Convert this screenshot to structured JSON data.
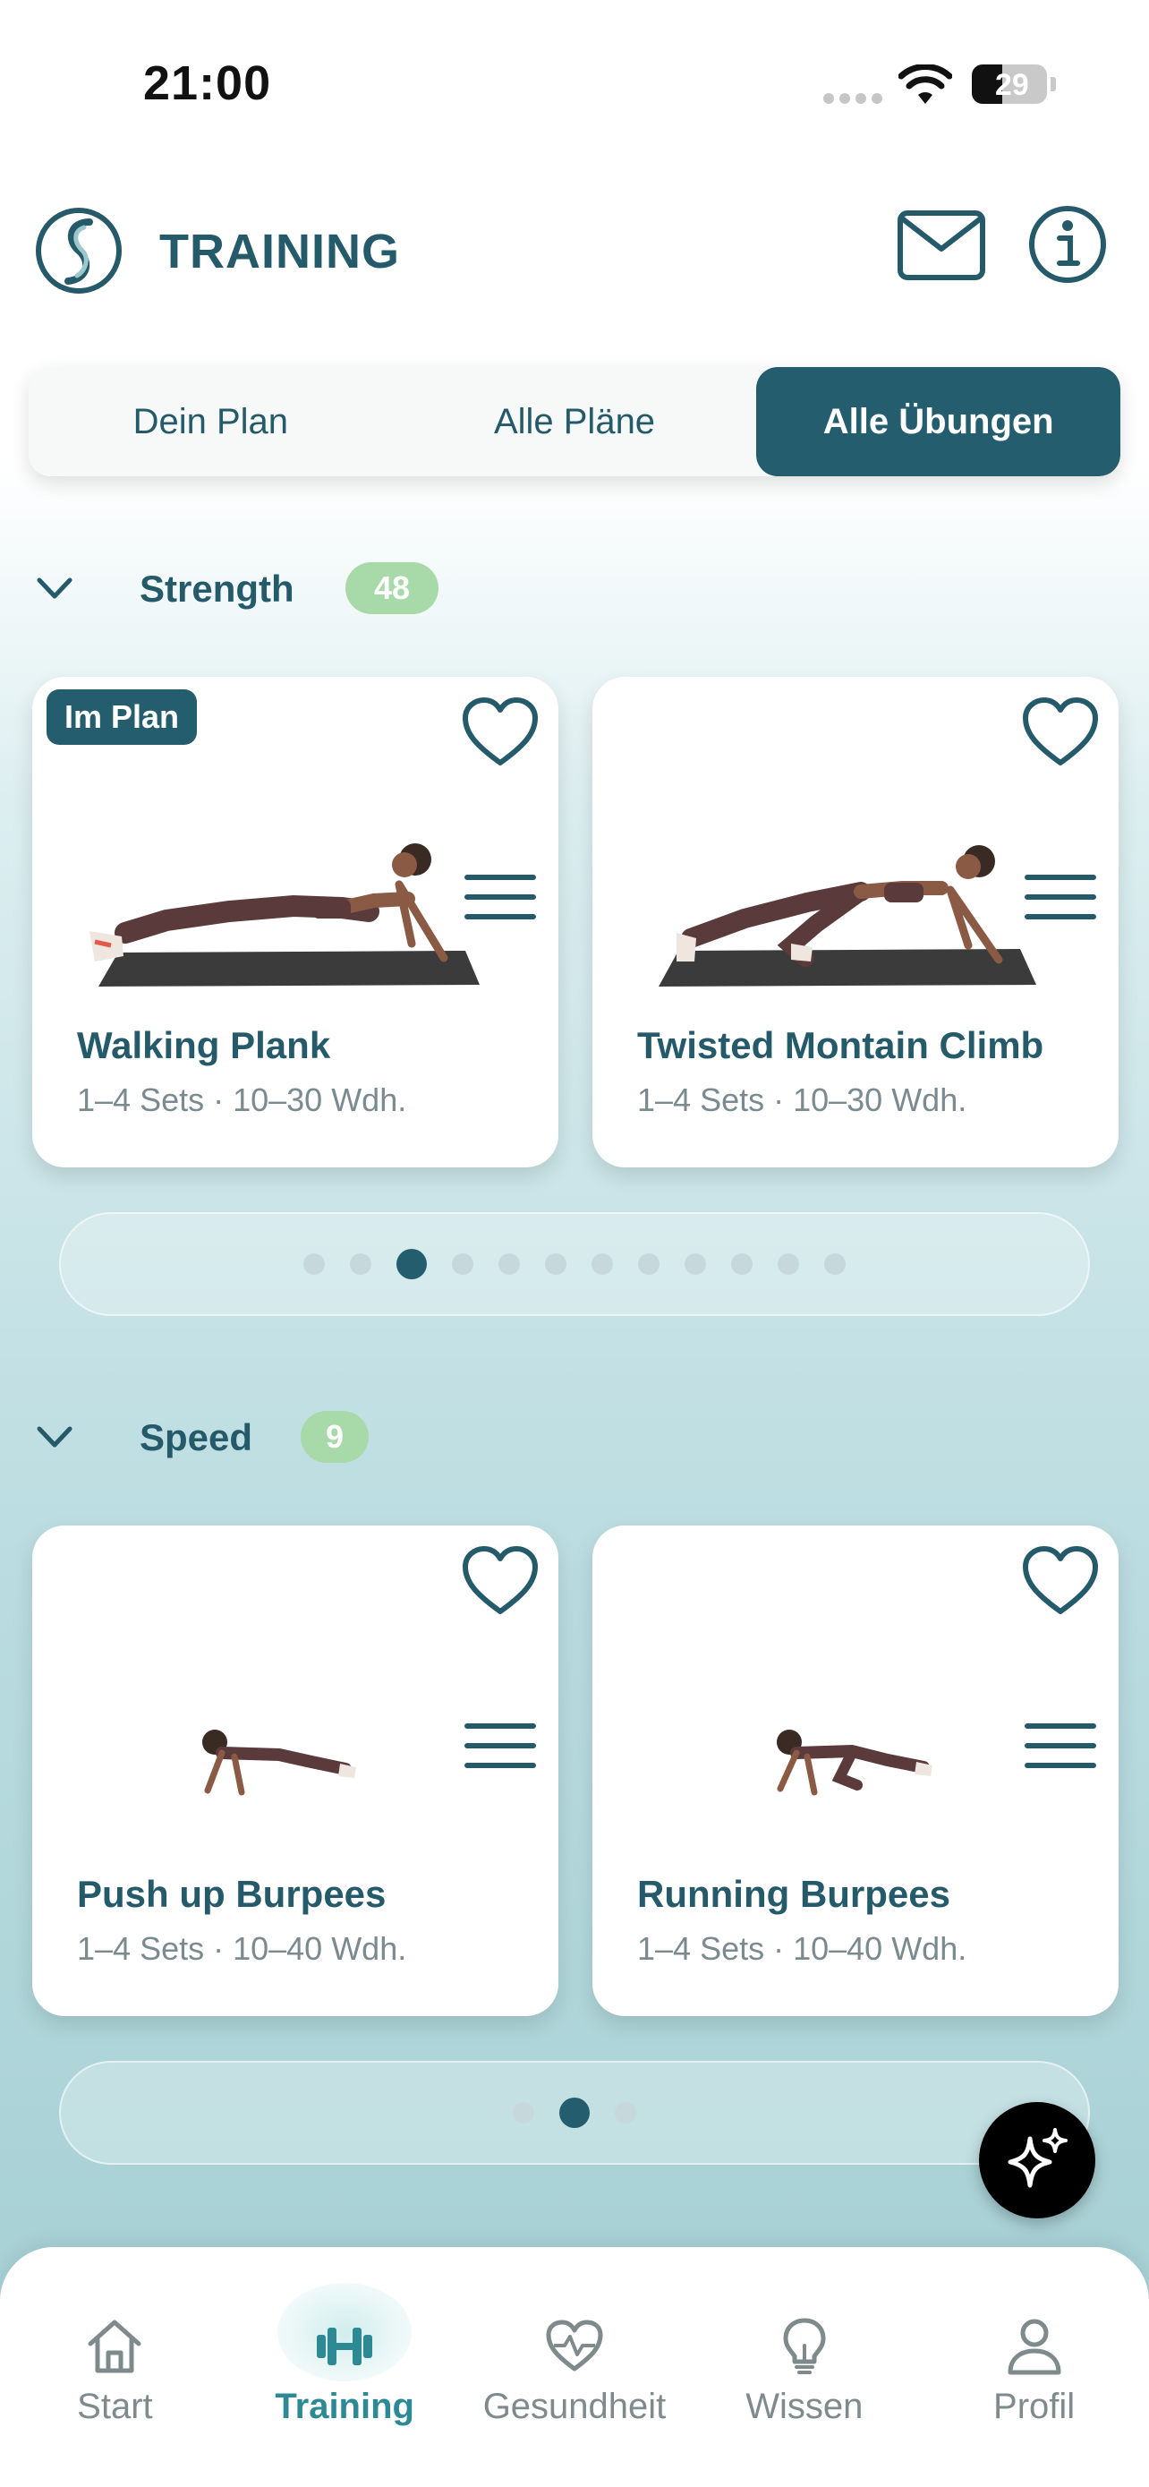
{
  "status_bar": {
    "time": "21:00",
    "battery": "29"
  },
  "header": {
    "title": "TRAINING",
    "icons": [
      "app-logo",
      "mail-icon",
      "info-icon"
    ]
  },
  "tabs": [
    {
      "label": "Dein Plan",
      "active": false
    },
    {
      "label": "Alle Pläne",
      "active": false
    },
    {
      "label": "Alle Übungen",
      "active": true
    }
  ],
  "sections": [
    {
      "title": "Strength",
      "count": "48",
      "cards": [
        {
          "name": "Walking Plank",
          "meta": "1–4 Sets · 10–30 Wdh.",
          "badge": "Im Plan"
        },
        {
          "name": "Twisted Montain Climb",
          "meta": "1–4 Sets · 10–30 Wdh.",
          "badge": ""
        }
      ],
      "pager": {
        "total": 12,
        "active_index": 2
      }
    },
    {
      "title": "Speed",
      "count": "9",
      "cards": [
        {
          "name": "Push up Burpees",
          "meta": "1–4 Sets · 10–40 Wdh.",
          "badge": ""
        },
        {
          "name": "Running Burpees",
          "meta": "1–4 Sets · 10–40 Wdh.",
          "badge": ""
        }
      ],
      "pager": {
        "total": 3,
        "active_index": 1
      }
    }
  ],
  "bottom_nav": [
    {
      "label": "Start",
      "icon": "home-icon",
      "active": false
    },
    {
      "label": "Training",
      "icon": "dumbbell-icon",
      "active": true
    },
    {
      "label": "Gesundheit",
      "icon": "heart-pulse-icon",
      "active": false
    },
    {
      "label": "Wissen",
      "icon": "lightbulb-icon",
      "active": false
    },
    {
      "label": "Profil",
      "icon": "profile-icon",
      "active": false
    }
  ],
  "colors": {
    "primary": "#245e6e",
    "badge_green": "#a8d9a8",
    "nav_active": "#2d8a94",
    "inactive": "#7f8a8d"
  }
}
